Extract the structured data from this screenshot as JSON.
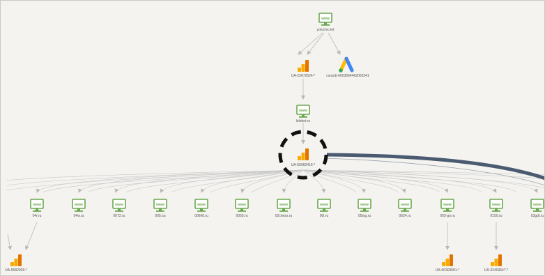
{
  "colors": {
    "www": "#6aa84f",
    "ga_dark": "#e37400",
    "ga_light": "#f9ab00",
    "edge": "#b8b8b8",
    "highlight_arrow": "#4a5a70",
    "circle": "#111111"
  },
  "nodes": {
    "root": {
      "label": "yolochv.net",
      "icon": "www-monitor-icon"
    },
    "ua_top": {
      "label": "UA-23672624-*",
      "icon": "analytics-icon"
    },
    "adsense": {
      "label": "ca-pub-6603064462062541",
      "icon": "adsense-icon"
    },
    "lolobot": {
      "label": "lolobot.ru",
      "icon": "www-monitor-icon"
    },
    "ua_center": {
      "label": "UA-55062416-*",
      "icon": "analytics-icon"
    },
    "sites": [
      {
        "label": "04r.ru"
      },
      {
        "label": "04w.ru"
      },
      {
        "label": "0072.ru"
      },
      {
        "label": "005.su"
      },
      {
        "label": "00660.ru"
      },
      {
        "label": "0055.ru"
      },
      {
        "label": "02chess.ru"
      },
      {
        "label": "00i.ru"
      },
      {
        "label": "05tog.ru"
      },
      {
        "label": "0624.ru"
      },
      {
        "label": "003-go.ru"
      },
      {
        "label": "0150.ru"
      },
      {
        "label": "03gdt.ru"
      }
    ],
    "ua_bottom": [
      {
        "label": "UA-5582909-*"
      },
      {
        "label": "UA-66303581-*"
      },
      {
        "label": "UA-32403647-*"
      }
    ]
  }
}
